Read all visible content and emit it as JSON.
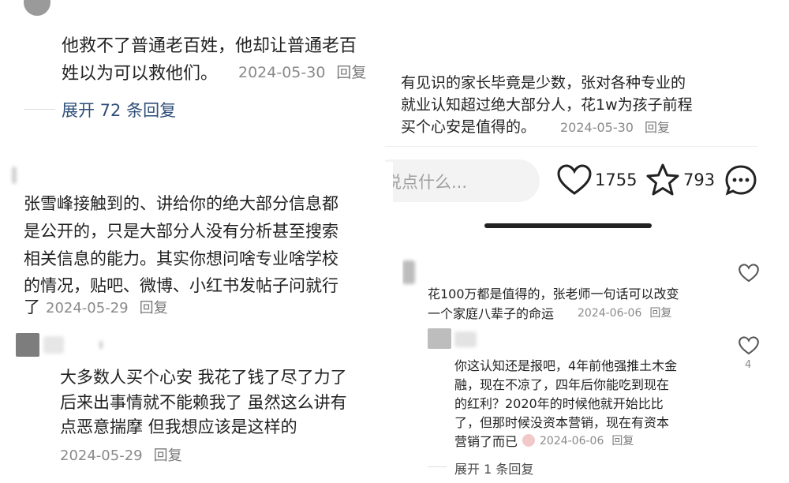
{
  "p1": {
    "lines": [
      "他救不了普通老百姓，他却让普通老百",
      "姓以为可以救他们。"
    ],
    "date": "2024-05-30",
    "reply": "回复",
    "expand": "展开 72 条回复"
  },
  "p2": {
    "lines": [
      "有见识的家长毕竟是少数，张对各种专业的",
      "就业认知超过绝大部分人，花1w为孩子前程",
      "买个心安是值得的。"
    ],
    "date": "2024-05-30",
    "reply": "回复",
    "input_placeholder": "说点什么...",
    "likes": "1755",
    "stars": "793"
  },
  "p3": {
    "lines": [
      "张雪峰接触到的、讲给你的绝大部分信息都",
      "是公开的，只是大部分人没有分析甚至搜索",
      "相关信息的能力。其实你想问啥专业啥学校",
      "的情况，贴吧、微博、小红书发帖子问就行",
      "了"
    ],
    "date": "2024-05-29",
    "reply": "回复"
  },
  "p4": {
    "lines": [
      "大多数人买个心安 我花了钱了尽了力了",
      "后来出事情就不能赖我了 虽然这么讲有",
      "点恶意揣摩 但我想应该是这样的"
    ],
    "date": "2024-05-29",
    "reply": "回复"
  },
  "p5": {
    "c1_lines": [
      "花100万都是值得的，张老师一句话可以改变",
      "一个家庭八辈子的命运"
    ],
    "c1_date": "2024-06-06",
    "c1_reply": "回复",
    "c2_lines": [
      "你这认知还是报吧，4年前他强推土木金",
      "融，现在不凉了，四年后你能吃到现在",
      "的红利？2020年的时候他就开始比比",
      "了，但那时候没资本营销，现在有资本",
      "营销了而已"
    ],
    "c2_date": "2024-06-06",
    "c2_reply": "回复",
    "c2_likes": "4",
    "expand": "展开 1 条回复"
  }
}
